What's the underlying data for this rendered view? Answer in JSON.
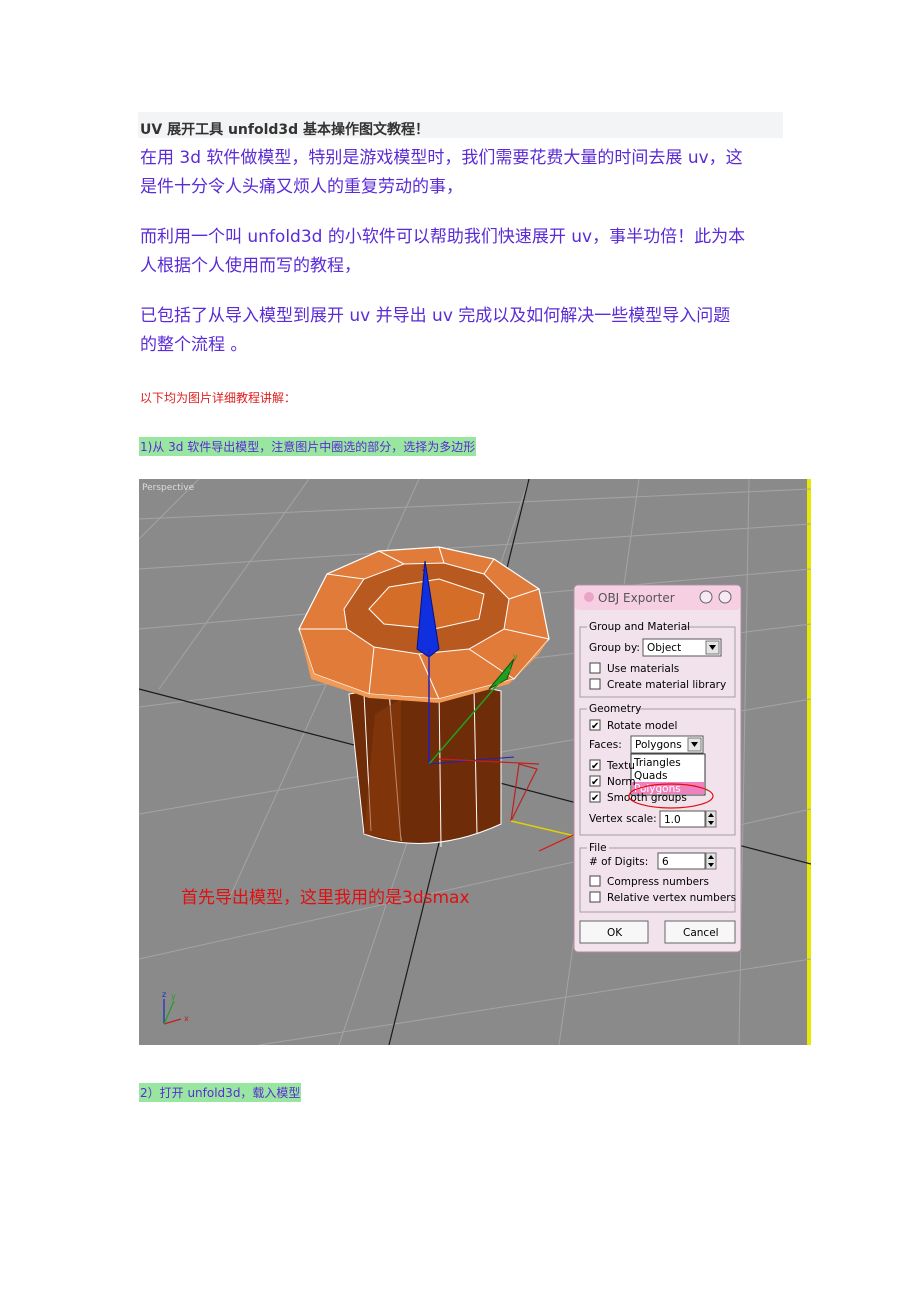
{
  "title": "UV 展开工具 unfold3d 基本操作图文教程！",
  "paragraphs": [
    {
      "line1": "在用 3d 软件做模型，特别是游戏模型时，我们需要花费大量的时间去展 uv，这",
      "line2": "是件十分令人头痛又烦人的重复劳动的事，"
    },
    {
      "line1": "而利用一个叫 unfold3d 的小软件可以帮助我们快速展开 uv，事半功倍！此为本",
      "line2": "人根据个人使用而写的教程，"
    },
    {
      "line1": "已包括了从导入模型到展开 uv 并导出 uv 完成以及如何解决一些模型导入问题",
      "line2": "的整个流程 。"
    }
  ],
  "note": "以下均为图片详细教程讲解：",
  "step1": "1)从 3d 软件导出模型，注意图片中圈选的部分，选择为多边形",
  "step2": "2）打开 unfold3d，载入模型",
  "screenshot": {
    "viewport_label": "Perspective",
    "annotation": "首先导出模型，这里我用的是3dsmax",
    "gizmo_axes": {
      "z": "z",
      "y": "y",
      "x": "x"
    },
    "dialog": {
      "title": "OBJ Exporter",
      "group_material": {
        "legend": "Group and Material",
        "group_by_label": "Group by:",
        "group_by_value": "Object",
        "use_materials": "Use materials",
        "create_library": "Create material library"
      },
      "geometry": {
        "legend": "Geometry",
        "rotate_model": "Rotate model",
        "faces_label": "Faces:",
        "faces_value": "Polygons",
        "options": [
          "Triangles",
          "Quads",
          "Polygons"
        ],
        "texture_partial": "Textu",
        "normals_partial": "Norm",
        "smooth_groups": "Smooth groups",
        "vertex_scale_label": "Vertex scale:",
        "vertex_scale_value": "1.0"
      },
      "file": {
        "legend": "File",
        "digits_label": "# of Digits:",
        "digits_value": "6",
        "compress": "Compress numbers",
        "relative": "Relative vertex numbers"
      },
      "ok": "OK",
      "cancel": "Cancel"
    }
  }
}
